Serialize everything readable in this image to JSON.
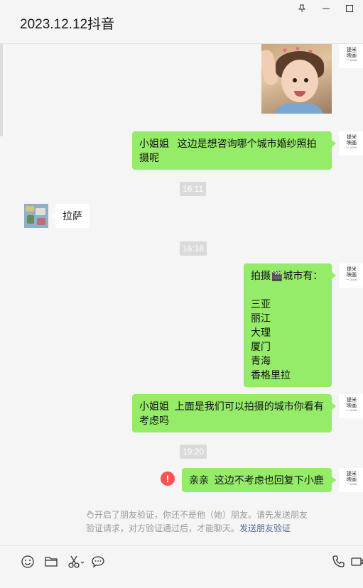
{
  "window": {
    "title": "2023.12.12抖音",
    "icons": [
      "pin-icon",
      "minimize-icon",
      "maximize-icon"
    ]
  },
  "self_avatar": {
    "logo_text": "提米\n映画",
    "logo_sub": "一 2020"
  },
  "messages": [
    {
      "type": "image",
      "from": "me",
      "description_icon": "photo-thumbnail"
    },
    {
      "type": "text",
      "from": "me",
      "text": "小姐姐   这边是想咨询哪个城市婚纱照拍摄呢"
    },
    {
      "type": "time",
      "text": "16:11"
    },
    {
      "type": "text",
      "from": "other",
      "text": "拉萨"
    },
    {
      "type": "time",
      "text": "16:18"
    },
    {
      "type": "text",
      "from": "me",
      "text": "拍摄🎬城市有：\n\n三亚\n丽江\n大理\n厦门\n青海\n香格里拉"
    },
    {
      "type": "text",
      "from": "me",
      "text": "小姐姐  上面是我们可以拍摄的城市你看有考虑吗"
    },
    {
      "type": "time",
      "text": "19:20"
    },
    {
      "type": "text",
      "from": "me",
      "text": "亲亲  这边不考虑也回复下小鹿",
      "status": "failed"
    }
  ],
  "notice": {
    "text": "开启了朋友验证，你还不是他（她）朋友。请先发送朋友验证请求，对方验证通过后，才能聊天。",
    "link": "发送朋友验证"
  },
  "toolbar": {
    "icons": [
      "emoji-icon",
      "folder-icon",
      "scissors-icon",
      "chat-bubble-icon",
      "phone-icon",
      "video-icon"
    ]
  },
  "colors": {
    "my_bubble": "#95ec69",
    "other_bubble": "#ffffff",
    "background": "#f5f5f5",
    "link": "#576b95",
    "alert": "#fa5151"
  }
}
